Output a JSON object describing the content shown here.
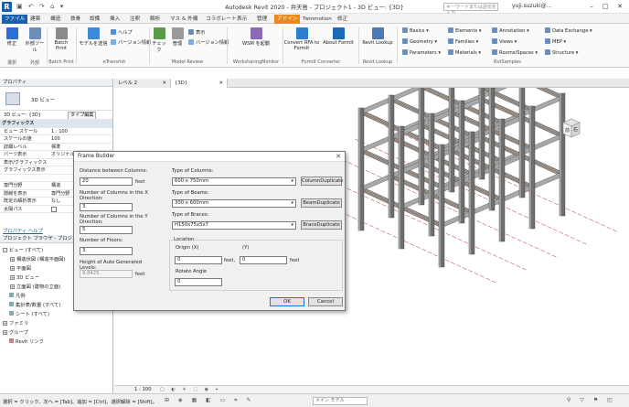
{
  "app": {
    "title": "Autodesk Revit 2020 - 弁天島 - プロジェクト1 - 3D ビュー: {3D}",
    "search_placeholder": "キーワードまたは語句を入力",
    "user": "yuji.suzuki@...",
    "logo": "R"
  },
  "menu_tabs": [
    "ファイル",
    "建築",
    "構造",
    "鉄骨",
    "設備",
    "挿入",
    "注釈",
    "解析",
    "マス & 外構",
    "コラボレート",
    "表示",
    "管理",
    "アドイン",
    "Twinmotion",
    "修正"
  ],
  "active_tab": "アドイン",
  "ribbon": {
    "buttons": [
      {
        "label": "修正",
        "icon": "arrow-cursor-icon"
      },
      {
        "label": "外部ツール",
        "icon": "wrench-icon"
      },
      {
        "label": "Batch Print",
        "icon": "printer-icon"
      },
      {
        "label": "モデルを送信",
        "icon": "upload-icon"
      },
      {
        "label": "ヘルプ",
        "icon": "help-icon"
      },
      {
        "label": "バージョン情報",
        "icon": "info-icon"
      },
      {
        "label": "チェック",
        "icon": "check-icon"
      },
      {
        "label": "管理",
        "icon": "list-icon"
      },
      {
        "label": "表示",
        "icon": "view-icon"
      },
      {
        "label": "バージョン情報",
        "icon": "info-icon"
      },
      {
        "label": "WSM を起動",
        "icon": "monitor-icon"
      },
      {
        "label": "Convert RFA to FormIt",
        "icon": "convert-icon"
      },
      {
        "label": "About FormIt",
        "icon": "formit-icon"
      },
      {
        "label": "Revit Lookup",
        "icon": "lookup-icon"
      }
    ],
    "groups": [
      "選択",
      "外部",
      "Batch Print",
      "eTransmit",
      "Model Review",
      "WorksharingMonitor",
      "FormIt Converter",
      "Revit Lookup",
      "RvtSamples"
    ],
    "small_buttons": [
      "Basics",
      "Geometry",
      "Parameters",
      "Elements",
      "Families",
      "Materials",
      "Annotation",
      "Views",
      "Rooms/Spaces",
      "Data Exchange",
      "MEP",
      "Structure"
    ]
  },
  "properties": {
    "header": "プロパティ",
    "type_name": "3D ビュー",
    "instance_label": "3D ビュー: {3D}",
    "edit_type": "タイプ編集",
    "rows": [
      {
        "name": "グラフィックス",
        "value": "",
        "category": true
      },
      {
        "name": "ビュー スケール",
        "value": "1 : 100"
      },
      {
        "name": "スケールの値",
        "value": "100"
      },
      {
        "name": "詳細レベル",
        "value": "標準"
      },
      {
        "name": "パーツ表示",
        "value": "オリジナル"
      },
      {
        "name": "表示/グラフィックス",
        "value": ""
      },
      {
        "name": "グラフィックス表示",
        "value": ""
      },
      {
        "name": "",
        "value": ""
      },
      {
        "name": "専門分野",
        "value": "構造"
      },
      {
        "name": "隠線を表示",
        "value": "専門分野"
      },
      {
        "name": "既定の解析表示",
        "value": "なし"
      },
      {
        "name": "太陽パス",
        "value": ""
      }
    ],
    "help_link": "プロパティ ヘルプ"
  },
  "browser": {
    "header": "プロジェクト ブラウザ - プロジェクト1",
    "items": [
      {
        "label": "ビュー (すべて)",
        "indent": 0,
        "toggle": "-"
      },
      {
        "label": "構造伏図 (構造平面図)",
        "indent": 1,
        "toggle": "+"
      },
      {
        "label": "平面図",
        "indent": 1,
        "toggle": "+"
      },
      {
        "label": "3D ビュー",
        "indent": 1,
        "toggle": "+"
      },
      {
        "label": "立面図 (建物の立面)",
        "indent": 1,
        "toggle": "+"
      },
      {
        "label": "凡例",
        "indent": 0,
        "toggle": ""
      },
      {
        "label": "集計表/数量 (すべて)",
        "indent": 0,
        "toggle": ""
      },
      {
        "label": "シート (すべて)",
        "indent": 0,
        "toggle": ""
      },
      {
        "label": "ファミリ",
        "indent": 0,
        "toggle": "+"
      },
      {
        "label": "グループ",
        "indent": 0,
        "toggle": "+"
      },
      {
        "label": "Revit リンク",
        "indent": 0,
        "toggle": ""
      }
    ]
  },
  "view_tabs": [
    {
      "label": "レベル 2",
      "active": false
    },
    {
      "label": "{3D}",
      "active": true
    }
  ],
  "view_scale": "1 : 100",
  "status_text": "選択 = クリック、次へ = [Tab]、追加 = [Ctrl]、選択解除 = [Shift]。",
  "main_model": "メイン モデル",
  "viewcube": {
    "front": "前",
    "right": "右"
  },
  "dialog": {
    "title": "Frame Builder",
    "distance_label": "Distance between Columns:",
    "distance_value": "20",
    "distance_unit": "feet",
    "cols_x_label": "Number of Columns in the X Direction:",
    "cols_x_value": "3",
    "cols_y_label": "Number of Columns in the Y Direction:",
    "cols_y_value": "5",
    "floors_label": "Number of Floors:",
    "floors_value": "3",
    "height_label": "Height of Auto Generated Levels:",
    "height_value": "9.8425",
    "height_unit": "feet",
    "columns_type_label": "Type of Columns:",
    "columns_type_value": "600 x 750mm",
    "beams_type_label": "Type of Beams:",
    "beams_type_value": "300 x 600mm",
    "braces_type_label": "Type of Braces:",
    "braces_type_value": "H150x75x5x7",
    "column_dup": "ColumnDuplicate",
    "beam_dup": "BeamDuplicate",
    "brace_dup": "BraceDuplicate",
    "location_label": "Location",
    "origin_label": "Origin (X)",
    "y_label": "(Y)",
    "origin_x": "0",
    "origin_y": "0",
    "feet_comma": "feet,",
    "feet2": "feet",
    "rotate_label": "Rotate Angle",
    "rotate_value": "0",
    "ok": "OK",
    "cancel": "Cancel"
  },
  "colors": {
    "accent_blue": "#1a5faa",
    "active_tab": "#e98a1e",
    "frame_column": "#6e6e6e",
    "frame_slab": "#a8a8a8",
    "frame_hatch": "#8a5a2a"
  }
}
